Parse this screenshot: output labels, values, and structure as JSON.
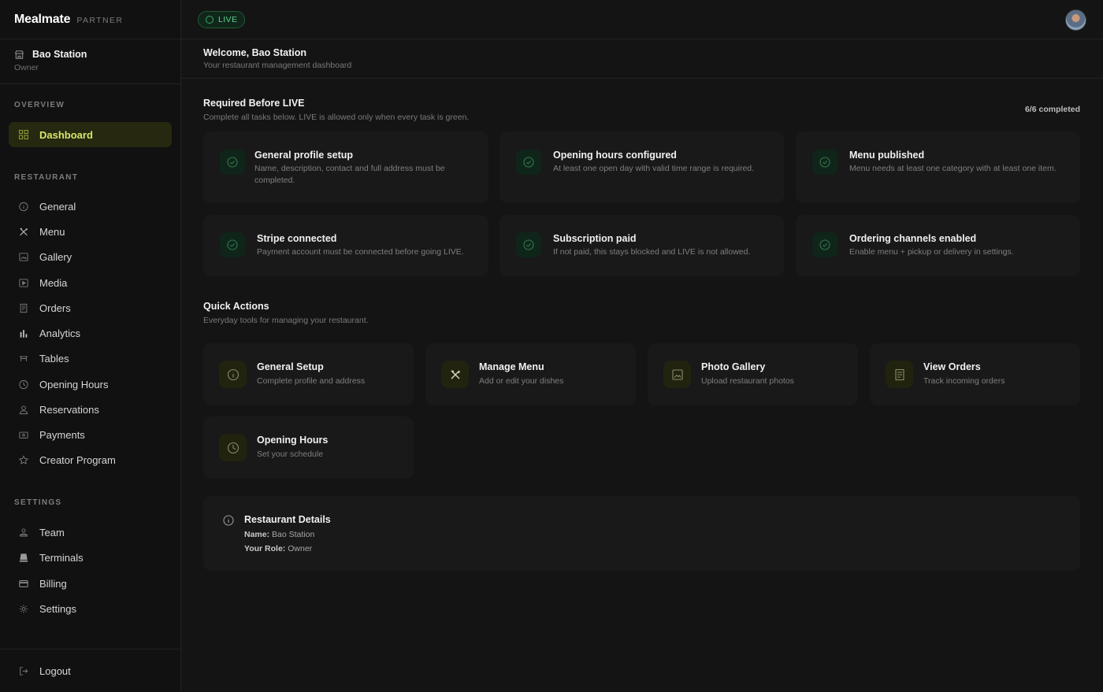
{
  "brand": {
    "name": "Mealmate",
    "tag": "PARTNER"
  },
  "account": {
    "name": "Bao Station",
    "role": "Owner"
  },
  "sidebar": {
    "overview_label": "OVERVIEW",
    "dashboard": "Dashboard",
    "restaurant_label": "RESTAURANT",
    "restaurant_items": [
      {
        "label": "General",
        "icon": "info-icon"
      },
      {
        "label": "Menu",
        "icon": "utensils-icon"
      },
      {
        "label": "Gallery",
        "icon": "image-icon"
      },
      {
        "label": "Media",
        "icon": "video-icon"
      },
      {
        "label": "Orders",
        "icon": "receipt-icon"
      },
      {
        "label": "Analytics",
        "icon": "bar-chart-icon"
      },
      {
        "label": "Tables",
        "icon": "table-icon"
      },
      {
        "label": "Opening Hours",
        "icon": "clock-icon"
      },
      {
        "label": "Reservations",
        "icon": "user-icon"
      },
      {
        "label": "Payments",
        "icon": "payment-icon"
      },
      {
        "label": "Creator Program",
        "icon": "star-icon"
      }
    ],
    "settings_label": "SETTINGS",
    "settings_items": [
      {
        "label": "Team",
        "icon": "team-icon"
      },
      {
        "label": "Terminals",
        "icon": "terminal-icon"
      },
      {
        "label": "Billing",
        "icon": "credit-card-icon"
      },
      {
        "label": "Settings",
        "icon": "gear-icon"
      }
    ],
    "logout": "Logout"
  },
  "topbar": {
    "status": "LIVE"
  },
  "welcome": {
    "title": "Welcome, Bao Station",
    "subtitle": "Your restaurant management dashboard"
  },
  "required": {
    "title": "Required Before LIVE",
    "subtitle": "Complete all tasks below. LIVE is allowed only when every task is green.",
    "progress": "6/6 completed",
    "tasks": [
      {
        "title": "General profile setup",
        "desc": "Name, description, contact and full address must be completed.",
        "done": true
      },
      {
        "title": "Opening hours configured",
        "desc": "At least one open day with valid time range is required.",
        "done": true
      },
      {
        "title": "Menu published",
        "desc": "Menu needs at least one category with at least one item.",
        "done": true
      },
      {
        "title": "Stripe connected",
        "desc": "Payment account must be connected before going LIVE.",
        "done": true
      },
      {
        "title": "Subscription paid",
        "desc": "If not paid, this stays blocked and LIVE is not allowed.",
        "done": true
      },
      {
        "title": "Ordering channels enabled",
        "desc": "Enable menu + pickup or delivery in settings.",
        "done": true
      }
    ]
  },
  "quick_actions": {
    "title": "Quick Actions",
    "subtitle": "Everyday tools for managing your restaurant.",
    "items": [
      {
        "title": "General Setup",
        "subtitle": "Complete profile and address",
        "icon": "info-icon"
      },
      {
        "title": "Manage Menu",
        "subtitle": "Add or edit your dishes",
        "icon": "utensils-icon"
      },
      {
        "title": "Photo Gallery",
        "subtitle": "Upload restaurant photos",
        "icon": "image-icon"
      },
      {
        "title": "View Orders",
        "subtitle": "Track incoming orders",
        "icon": "receipt-icon"
      },
      {
        "title": "Opening Hours",
        "subtitle": "Set your schedule",
        "icon": "clock-icon"
      }
    ]
  },
  "details": {
    "title": "Restaurant Details",
    "name_label": "Name:",
    "name_value": "Bao Station",
    "role_label": "Your Role:",
    "role_value": "Owner"
  },
  "colors": {
    "accent": "#d9e56b",
    "success": "#5fd08e",
    "background": "#141414",
    "card": "#191919"
  }
}
